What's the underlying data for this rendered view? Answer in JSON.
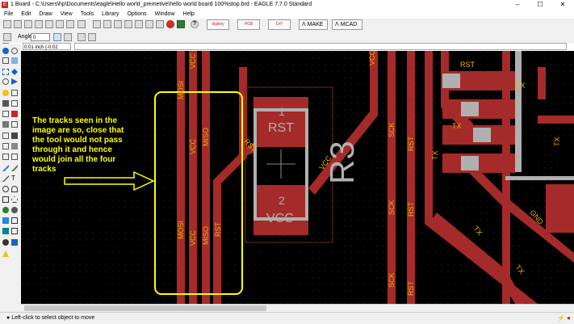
{
  "window": {
    "title": "1 Board - C:\\Users\\hp\\Documents\\eagle\\Hello world_premetive\\hello world board 100%stop.brd - EAGLE 7.7.0 Standard",
    "minimize": "–",
    "maximize": "☐",
    "close": "✕"
  },
  "menu": [
    "File",
    "Edit",
    "Draw",
    "View",
    "Tools",
    "Library",
    "Options",
    "Window",
    "Help"
  ],
  "toolbar": {
    "buttons": [
      "digikey",
      "PCB",
      "DiY",
      "MAKE",
      "MCAD"
    ],
    "help": "?"
  },
  "options": {
    "angle_label": "Angle:",
    "angle_value": "0"
  },
  "coords": {
    "value": "0.01 inch (-0.02 0.79)"
  },
  "annotation": {
    "text": "The tracks seen in the image are so, close that the tool would not pass through it and hence would join all the four tracks",
    "lines": [
      "The tracks seen in the",
      "image are so, close that",
      "the tool would not pass",
      "through it and hence",
      "would join all the four",
      "tracks"
    ]
  },
  "board_labels": {
    "mosi": "MOSI",
    "vcc": "VCC",
    "miso": "MISO",
    "rst": "RST",
    "sck": "SCK",
    "tx": "TX",
    "rx": "RX",
    "gnd": "GND",
    "r3": "R3",
    "pad1": "1",
    "pad2": "2"
  },
  "status": {
    "text": "Left-click to select object to move"
  },
  "colors": {
    "trace": "#a52a2a",
    "silk": "#b0b0b0",
    "label": "#e6b800",
    "annotation": "#ffff00"
  }
}
